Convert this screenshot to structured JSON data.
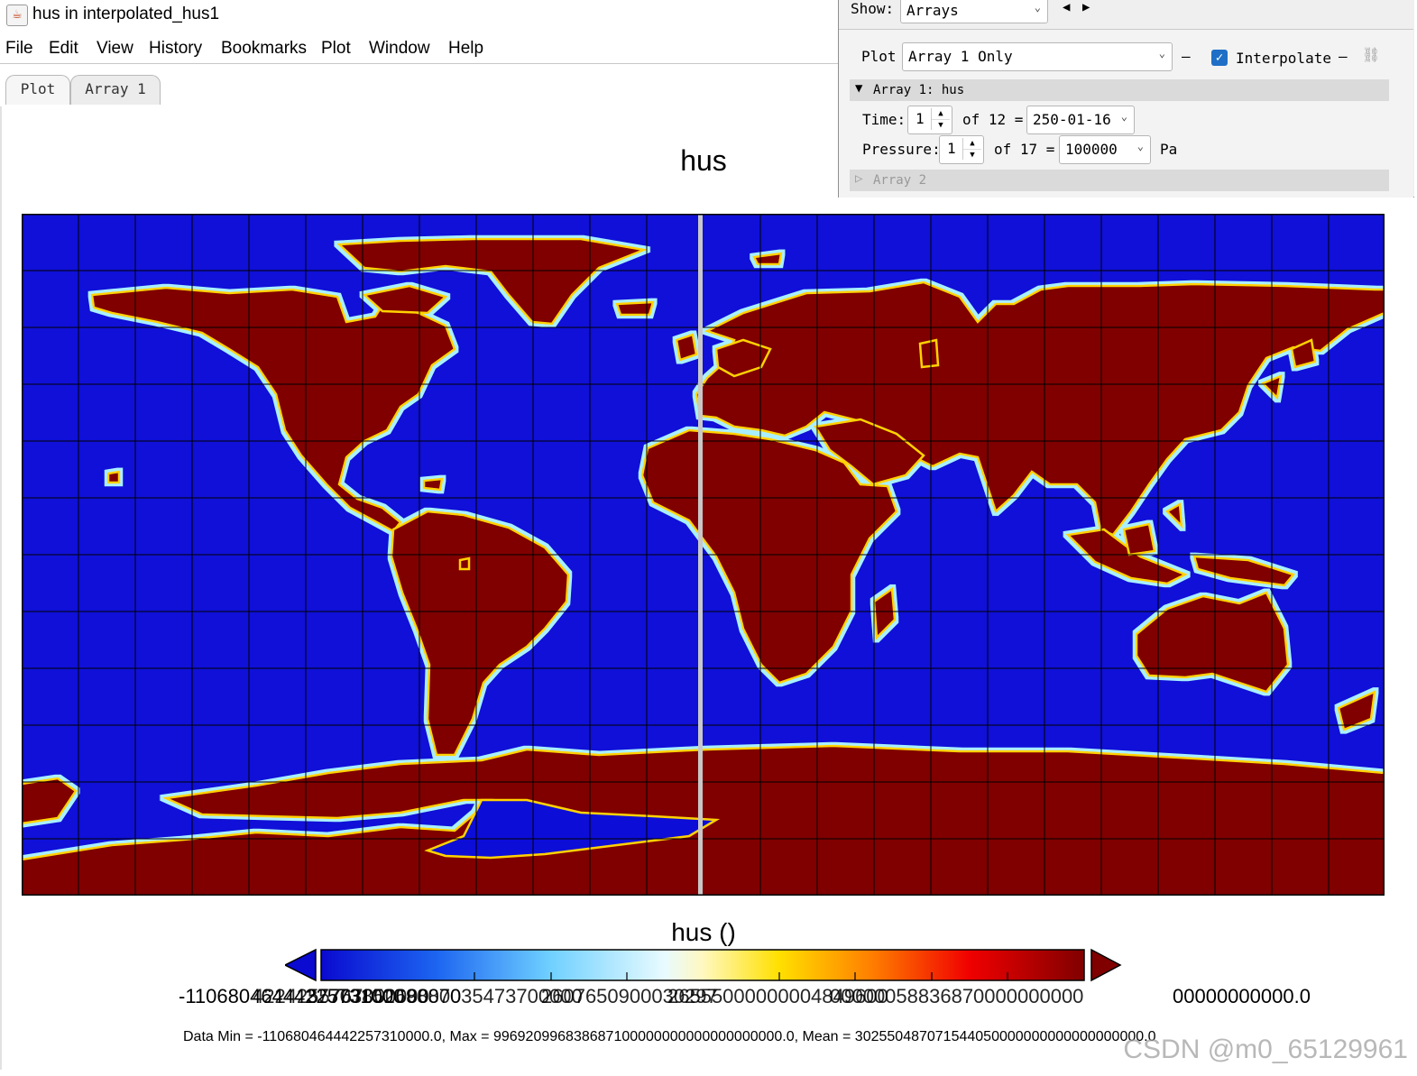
{
  "window": {
    "title": "hus in interpolated_hus1",
    "app_icon": "java-cup-icon"
  },
  "menu": [
    "File",
    "Edit",
    "View",
    "History",
    "Bookmarks",
    "Plot",
    "Window",
    "Help"
  ],
  "tabs": [
    {
      "label": "Plot",
      "active": true
    },
    {
      "label": "Array 1",
      "active": false
    }
  ],
  "panel": {
    "show_label": "Show:",
    "show_value": "Arrays",
    "plot_label": "Plot",
    "plot_value": "Array 1 Only",
    "interpolate_label": "Interpolate",
    "interpolate_checked": true,
    "array1_header": "Array 1: hus",
    "time_label": "Time:",
    "time_index": "1",
    "time_of": "of 12 =",
    "time_value": "250-01-16",
    "pressure_label": "Pressure:",
    "pressure_index": "1",
    "pressure_of": "of 17 =",
    "pressure_value": "100000",
    "pressure_unit": "Pa",
    "array2_header": "Array 2"
  },
  "plot": {
    "title": "hus",
    "colorbar_title": "hus ()",
    "colorbar_labels": [
      "-11068046444225731000",
      "4224255767000000",
      "37703852680000",
      "9887035473700000",
      "2607650900030297",
      "26555000000004849600",
      "00000058836870000000000",
      "00000000000.0"
    ],
    "stats": "Data Min = -110680464442257310000.0, Max = 996920996838687100000000000000000000.0, Mean = 302550487071544050000000000000000000.0",
    "colors": {
      "ocean": "#1010d8",
      "land": "#800000",
      "grid": "#000000"
    }
  },
  "watermark": "CSDN @m0_65129961"
}
